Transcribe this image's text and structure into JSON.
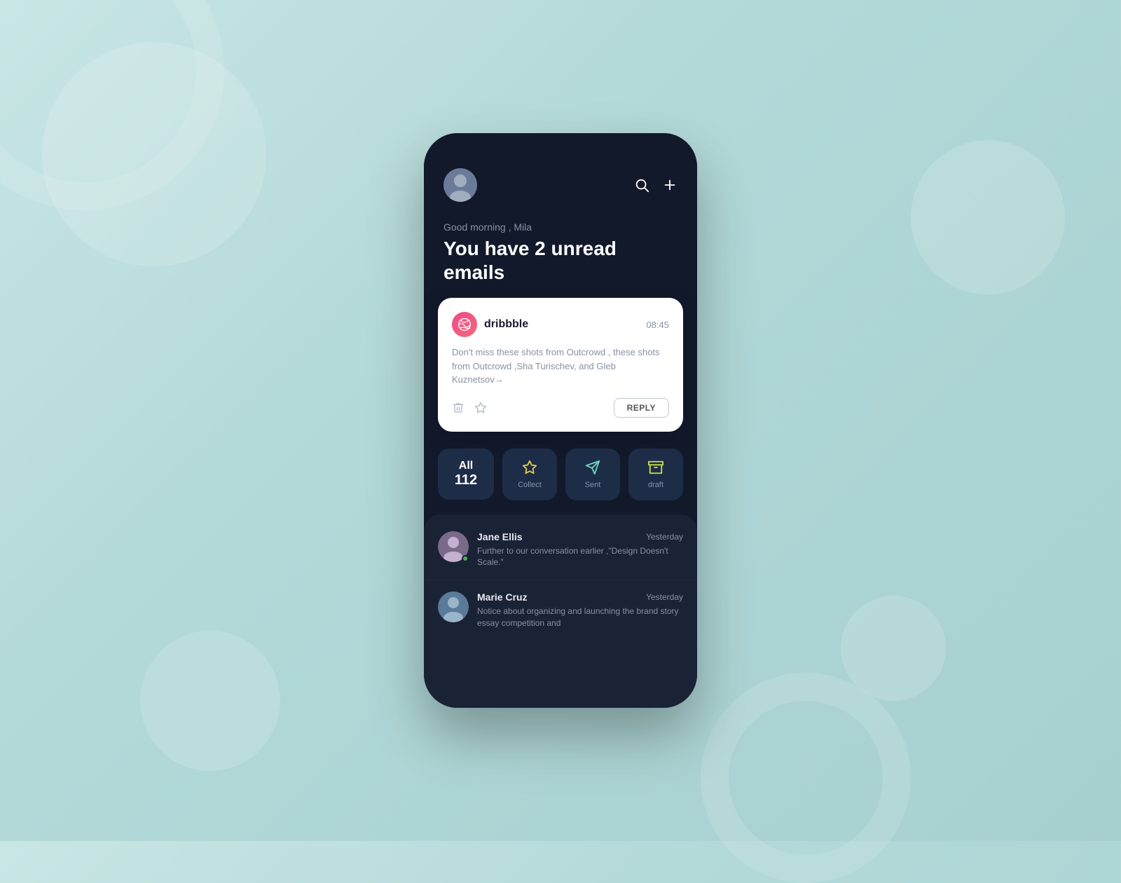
{
  "background": {
    "color": "#b2d8d8"
  },
  "header": {
    "greeting_sub": "Good morning , Mila",
    "greeting_main": "You have 2 unread emails",
    "search_icon": "search-icon",
    "add_icon": "add-icon"
  },
  "email_card": {
    "sender_name": "dribbble",
    "time": "08:45",
    "body": "Don't miss these shots from Outcrowd , these shots from Outcrowd ,Sha Turischev, and Gleb Kuznetsov→",
    "reply_label": "REPLY"
  },
  "tabs": [
    {
      "id": "all",
      "label": "All",
      "count": "112",
      "icon": null
    },
    {
      "id": "collect",
      "label": "Collect",
      "icon": "star-icon",
      "count": null
    },
    {
      "id": "sent",
      "label": "Sent",
      "icon": "send-icon",
      "count": null
    },
    {
      "id": "draft",
      "label": "draft",
      "icon": "archive-icon",
      "count": null
    }
  ],
  "email_list": [
    {
      "id": 1,
      "from": "Jane Ellis",
      "date": "Yesterday",
      "preview": "Further to our conversation earlier ,\"Design Doesn't Scale.\"",
      "online": true
    },
    {
      "id": 2,
      "from": "Marie Cruz",
      "date": "Yesterday",
      "preview": "Notice about organizing and launching the brand story essay competition and",
      "online": false
    }
  ]
}
